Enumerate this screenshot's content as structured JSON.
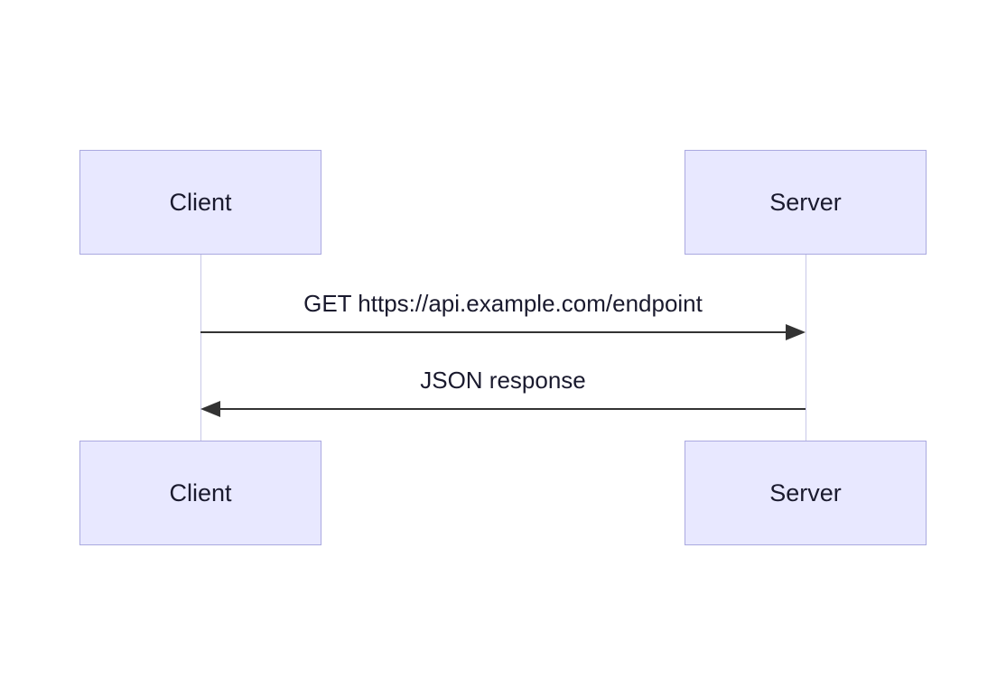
{
  "chart_data": {
    "type": "sequence_diagram",
    "actors": [
      {
        "id": "client",
        "label": "Client"
      },
      {
        "id": "server",
        "label": "Server"
      }
    ],
    "messages": [
      {
        "from": "client",
        "to": "server",
        "label": "GET https://api.example.com/endpoint"
      },
      {
        "from": "server",
        "to": "client",
        "label": "JSON response"
      }
    ]
  },
  "colors": {
    "actor_fill": "#e8e8ff",
    "actor_border": "#aaa9e0",
    "line": "#333333",
    "lifeline": "#c8c8e8"
  }
}
